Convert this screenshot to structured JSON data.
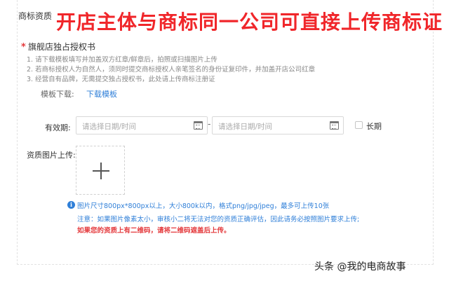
{
  "section_title": "商标资质",
  "banner_text": "开店主体与商标同一公司可直接上传商标证",
  "required_mark": "*",
  "auth_title": "旗舰店独占授权书",
  "rules": [
    "1. 请下载模板填写并加盖双方红章/鲜章后，拍照或扫描图片上传",
    "2. 若商标授权人为自然人，须同时提交商标授权人亲笔签名的身份证复印件，并加盖开店公司红章",
    "3. 经营自有品牌，无需提交独占授权书，此处请上传商标注册证"
  ],
  "template": {
    "label": "模板下载:",
    "link": "下载模板"
  },
  "validity": {
    "label": "有效期:",
    "start_placeholder": "请选择日期/时间",
    "end_placeholder": "请选择日期/时间",
    "separator": "-",
    "long_term_label": "长期",
    "long_term_checked": false
  },
  "image_upload": {
    "label": "资质图片上传:"
  },
  "notes": {
    "info_icon": "i",
    "line1": "图片尺寸800px*800px以上，大小800k以内，格式png/jpg/jpeg，最多可上传10张",
    "line2": "注意：如果图片像素太小，审核小二将无法对您的资质正确评估，因此请务必按照图片要求上传;",
    "line3": "如果您的资质上有二维码，请将二维码遮盖后上传。"
  },
  "watermark": "头条 @我的电商故事",
  "colors": {
    "banner": "#f0262a",
    "link": "#2f7fd8",
    "warning": "#e4393c"
  }
}
